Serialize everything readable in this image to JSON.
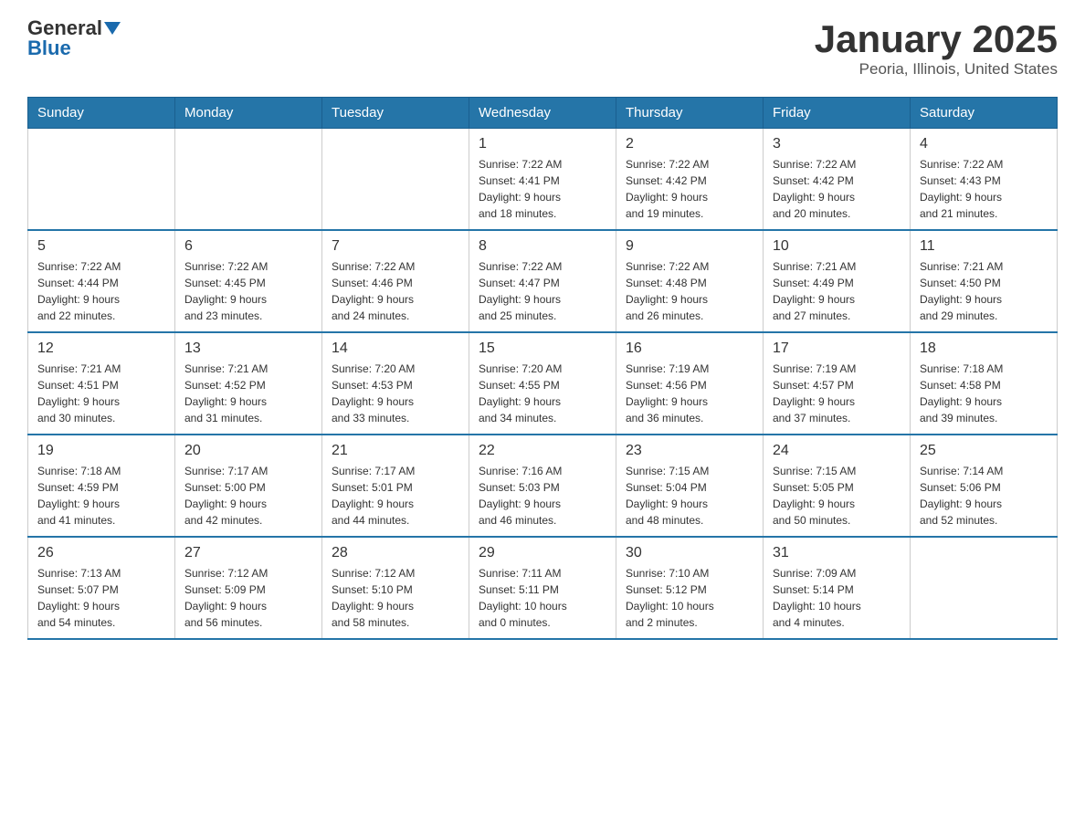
{
  "logo": {
    "general": "General",
    "blue": "Blue"
  },
  "title": "January 2025",
  "subtitle": "Peoria, Illinois, United States",
  "days_of_week": [
    "Sunday",
    "Monday",
    "Tuesday",
    "Wednesday",
    "Thursday",
    "Friday",
    "Saturday"
  ],
  "weeks": [
    [
      {
        "day": "",
        "info": ""
      },
      {
        "day": "",
        "info": ""
      },
      {
        "day": "",
        "info": ""
      },
      {
        "day": "1",
        "info": "Sunrise: 7:22 AM\nSunset: 4:41 PM\nDaylight: 9 hours\nand 18 minutes."
      },
      {
        "day": "2",
        "info": "Sunrise: 7:22 AM\nSunset: 4:42 PM\nDaylight: 9 hours\nand 19 minutes."
      },
      {
        "day": "3",
        "info": "Sunrise: 7:22 AM\nSunset: 4:42 PM\nDaylight: 9 hours\nand 20 minutes."
      },
      {
        "day": "4",
        "info": "Sunrise: 7:22 AM\nSunset: 4:43 PM\nDaylight: 9 hours\nand 21 minutes."
      }
    ],
    [
      {
        "day": "5",
        "info": "Sunrise: 7:22 AM\nSunset: 4:44 PM\nDaylight: 9 hours\nand 22 minutes."
      },
      {
        "day": "6",
        "info": "Sunrise: 7:22 AM\nSunset: 4:45 PM\nDaylight: 9 hours\nand 23 minutes."
      },
      {
        "day": "7",
        "info": "Sunrise: 7:22 AM\nSunset: 4:46 PM\nDaylight: 9 hours\nand 24 minutes."
      },
      {
        "day": "8",
        "info": "Sunrise: 7:22 AM\nSunset: 4:47 PM\nDaylight: 9 hours\nand 25 minutes."
      },
      {
        "day": "9",
        "info": "Sunrise: 7:22 AM\nSunset: 4:48 PM\nDaylight: 9 hours\nand 26 minutes."
      },
      {
        "day": "10",
        "info": "Sunrise: 7:21 AM\nSunset: 4:49 PM\nDaylight: 9 hours\nand 27 minutes."
      },
      {
        "day": "11",
        "info": "Sunrise: 7:21 AM\nSunset: 4:50 PM\nDaylight: 9 hours\nand 29 minutes."
      }
    ],
    [
      {
        "day": "12",
        "info": "Sunrise: 7:21 AM\nSunset: 4:51 PM\nDaylight: 9 hours\nand 30 minutes."
      },
      {
        "day": "13",
        "info": "Sunrise: 7:21 AM\nSunset: 4:52 PM\nDaylight: 9 hours\nand 31 minutes."
      },
      {
        "day": "14",
        "info": "Sunrise: 7:20 AM\nSunset: 4:53 PM\nDaylight: 9 hours\nand 33 minutes."
      },
      {
        "day": "15",
        "info": "Sunrise: 7:20 AM\nSunset: 4:55 PM\nDaylight: 9 hours\nand 34 minutes."
      },
      {
        "day": "16",
        "info": "Sunrise: 7:19 AM\nSunset: 4:56 PM\nDaylight: 9 hours\nand 36 minutes."
      },
      {
        "day": "17",
        "info": "Sunrise: 7:19 AM\nSunset: 4:57 PM\nDaylight: 9 hours\nand 37 minutes."
      },
      {
        "day": "18",
        "info": "Sunrise: 7:18 AM\nSunset: 4:58 PM\nDaylight: 9 hours\nand 39 minutes."
      }
    ],
    [
      {
        "day": "19",
        "info": "Sunrise: 7:18 AM\nSunset: 4:59 PM\nDaylight: 9 hours\nand 41 minutes."
      },
      {
        "day": "20",
        "info": "Sunrise: 7:17 AM\nSunset: 5:00 PM\nDaylight: 9 hours\nand 42 minutes."
      },
      {
        "day": "21",
        "info": "Sunrise: 7:17 AM\nSunset: 5:01 PM\nDaylight: 9 hours\nand 44 minutes."
      },
      {
        "day": "22",
        "info": "Sunrise: 7:16 AM\nSunset: 5:03 PM\nDaylight: 9 hours\nand 46 minutes."
      },
      {
        "day": "23",
        "info": "Sunrise: 7:15 AM\nSunset: 5:04 PM\nDaylight: 9 hours\nand 48 minutes."
      },
      {
        "day": "24",
        "info": "Sunrise: 7:15 AM\nSunset: 5:05 PM\nDaylight: 9 hours\nand 50 minutes."
      },
      {
        "day": "25",
        "info": "Sunrise: 7:14 AM\nSunset: 5:06 PM\nDaylight: 9 hours\nand 52 minutes."
      }
    ],
    [
      {
        "day": "26",
        "info": "Sunrise: 7:13 AM\nSunset: 5:07 PM\nDaylight: 9 hours\nand 54 minutes."
      },
      {
        "day": "27",
        "info": "Sunrise: 7:12 AM\nSunset: 5:09 PM\nDaylight: 9 hours\nand 56 minutes."
      },
      {
        "day": "28",
        "info": "Sunrise: 7:12 AM\nSunset: 5:10 PM\nDaylight: 9 hours\nand 58 minutes."
      },
      {
        "day": "29",
        "info": "Sunrise: 7:11 AM\nSunset: 5:11 PM\nDaylight: 10 hours\nand 0 minutes."
      },
      {
        "day": "30",
        "info": "Sunrise: 7:10 AM\nSunset: 5:12 PM\nDaylight: 10 hours\nand 2 minutes."
      },
      {
        "day": "31",
        "info": "Sunrise: 7:09 AM\nSunset: 5:14 PM\nDaylight: 10 hours\nand 4 minutes."
      },
      {
        "day": "",
        "info": ""
      }
    ]
  ]
}
